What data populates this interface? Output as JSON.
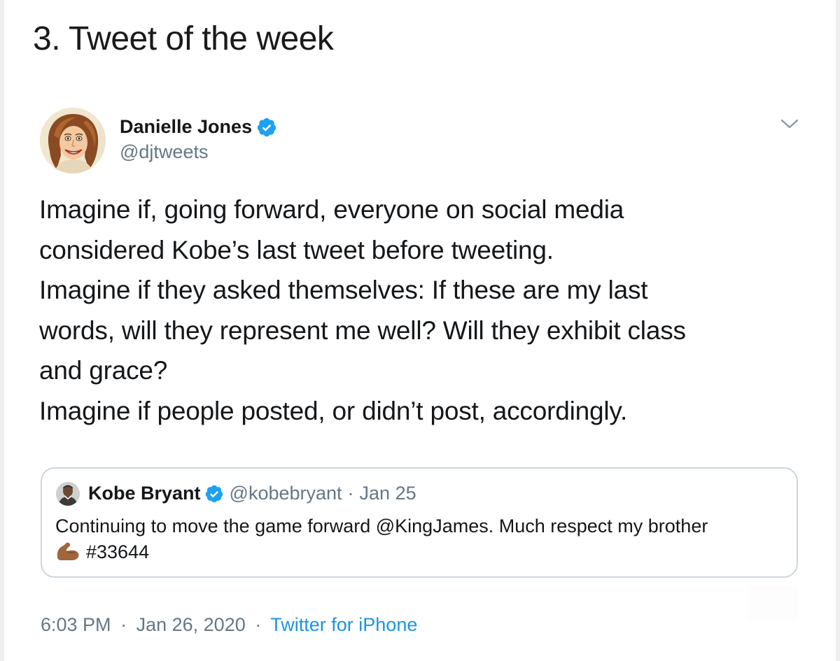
{
  "page": {
    "heading": "3. Tweet of the week"
  },
  "tweet": {
    "author": {
      "name": "Danielle Jones",
      "handle": "@djtweets",
      "verified_icon": "verified-badge-icon",
      "avatar_icon": "caricature-avatar"
    },
    "menu_icon": "chevron-down-icon",
    "body_lines": [
      "Imagine if, going forward, everyone on social media",
      "considered Kobe’s last tweet before tweeting.",
      "Imagine if they asked themselves: If these are my last",
      "words, will they represent me well? Will they exhibit class",
      "and grace?",
      "Imagine if people posted, or didn’t post, accordingly."
    ],
    "quoted": {
      "author_name": "Kobe Bryant",
      "handle": "@kobebryant",
      "separator": "·",
      "date": "Jan 25",
      "text_line_1": "Continuing to move the game forward @KingJames. Much respect my brother",
      "text_line_2": "#33644",
      "emoji_icon": "flexed-biceps-icon"
    },
    "footer": {
      "time": "6:03 PM",
      "separator": "·",
      "date": "Jan 26, 2020",
      "separator_2": "·",
      "source": "Twitter for iPhone"
    }
  },
  "colors": {
    "text_primary": "#14171a",
    "text_secondary": "#657786",
    "verified_blue": "#1da1f2",
    "link_blue": "#1b95e0",
    "border": "#ccd6dd"
  }
}
